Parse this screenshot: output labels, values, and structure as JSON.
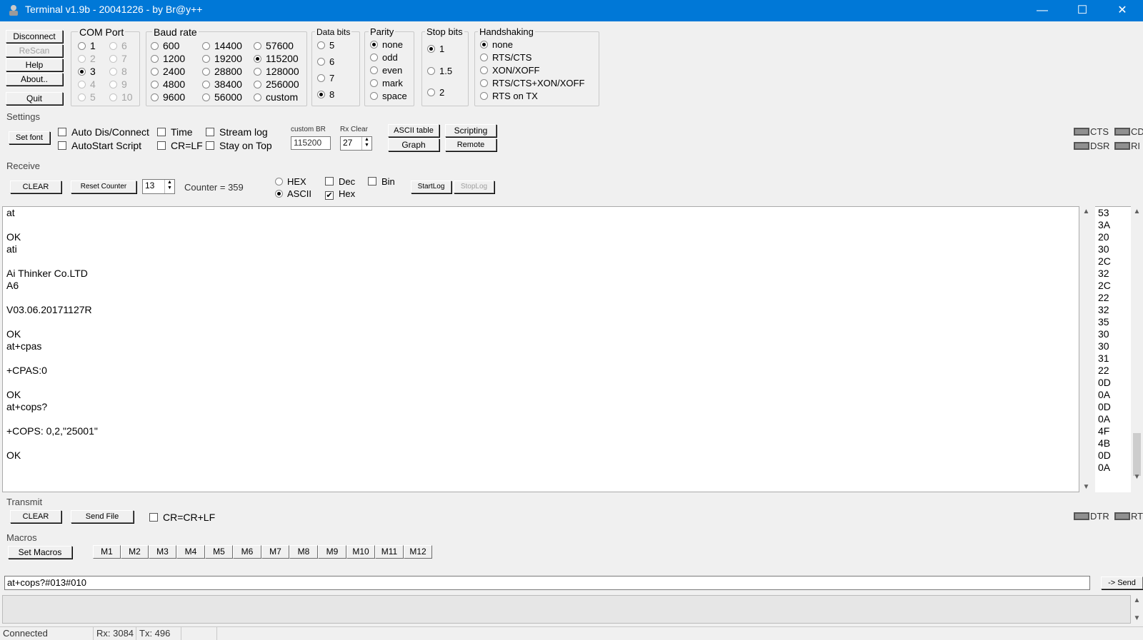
{
  "window": {
    "title": "Terminal v1.9b - 20041226 - by Br@y++",
    "minimize_glyph": "—",
    "maximize_glyph": "☐",
    "close_glyph": "✕",
    "icon": "terminal-app-icon"
  },
  "left_buttons": {
    "disconnect": "Disconnect",
    "rescan": "ReScan",
    "help": "Help",
    "about": "About..",
    "quit": "Quit"
  },
  "com_port": {
    "title": "COM Port",
    "options": [
      "1",
      "2",
      "3",
      "4",
      "5",
      "6",
      "7",
      "8",
      "9",
      "10"
    ],
    "selected": "3"
  },
  "baud_rate": {
    "title": "Baud rate",
    "options": [
      "600",
      "1200",
      "2400",
      "4800",
      "9600",
      "14400",
      "19200",
      "28800",
      "38400",
      "56000",
      "57600",
      "115200",
      "128000",
      "256000",
      "custom"
    ],
    "selected": "115200"
  },
  "data_bits": {
    "title": "Data bits",
    "options": [
      "5",
      "6",
      "7",
      "8"
    ],
    "selected": "8"
  },
  "parity": {
    "title": "Parity",
    "options": [
      "none",
      "odd",
      "even",
      "mark",
      "space"
    ],
    "selected": "none"
  },
  "stop_bits": {
    "title": "Stop bits",
    "options": [
      "1",
      "1.5",
      "2"
    ],
    "selected": "1"
  },
  "handshaking": {
    "title": "Handshaking",
    "options": [
      "none",
      "RTS/CTS",
      "XON/XOFF",
      "RTS/CTS+XON/XOFF",
      "RTS on TX"
    ],
    "selected": "none"
  },
  "settings": {
    "label": "Settings",
    "set_font": "Set font",
    "auto_disconnect": "Auto Dis/Connect",
    "autostart_script": "AutoStart Script",
    "time": "Time",
    "crlf": "CR=LF",
    "stream_log": "Stream log",
    "stay_on_top": "Stay on Top",
    "custom_br_label": "custom BR",
    "custom_br_value": "115200",
    "rx_clear_label": "Rx Clear",
    "rx_clear_value": "27",
    "ascii_table": "ASCII table",
    "scripting": "Scripting",
    "graph": "Graph",
    "remote": "Remote",
    "leds": [
      "CTS",
      "CD",
      "DSR",
      "RI"
    ]
  },
  "receive": {
    "label": "Receive",
    "clear": "CLEAR",
    "reset_counter": "Reset Counter",
    "counter_spin_value": "13",
    "counter_text": "Counter = 359",
    "hex_radio": "HEX",
    "ascii_radio": "ASCII",
    "dec_check": "Dec",
    "hex_check": "Hex",
    "bin_check": "Bin",
    "checkmark": "✔",
    "start_log": "StartLog",
    "stop_log": "StopLog",
    "lines": [
      "at",
      "",
      "OK",
      "ati",
      "",
      "Ai Thinker Co.LTD",
      "A6",
      "",
      "V03.06.20171127R",
      "",
      "OK",
      "at+cpas",
      "",
      "+CPAS:0",
      "",
      "OK",
      "at+cops?",
      "",
      "+COPS: 0,2,\"25001\"",
      "",
      "OK"
    ],
    "hex_values": [
      "53",
      "3A",
      "20",
      "30",
      "2C",
      "32",
      "2C",
      "22",
      "32",
      "35",
      "30",
      "30",
      "31",
      "22",
      "0D",
      "0A",
      "0D",
      "0A",
      "4F",
      "4B",
      "0D",
      "0A"
    ],
    "scroll_up": "▲",
    "scroll_down": "▼"
  },
  "transmit": {
    "label": "Transmit",
    "clear": "CLEAR",
    "send_file": "Send File",
    "cr_crlf": "CR=CR+LF",
    "leds": [
      "DTR",
      "RTS"
    ]
  },
  "macros": {
    "label": "Macros",
    "set_macros": "Set Macros",
    "buttons": [
      "M1",
      "M2",
      "M3",
      "M4",
      "M5",
      "M6",
      "M7",
      "M8",
      "M9",
      "M10",
      "M11",
      "M12"
    ]
  },
  "send": {
    "input_value": "at+cops?#013#010",
    "send_button": "-> Send"
  },
  "status": {
    "connection": "Connected",
    "rx": "Rx: 3084",
    "tx": "Tx: 496"
  }
}
